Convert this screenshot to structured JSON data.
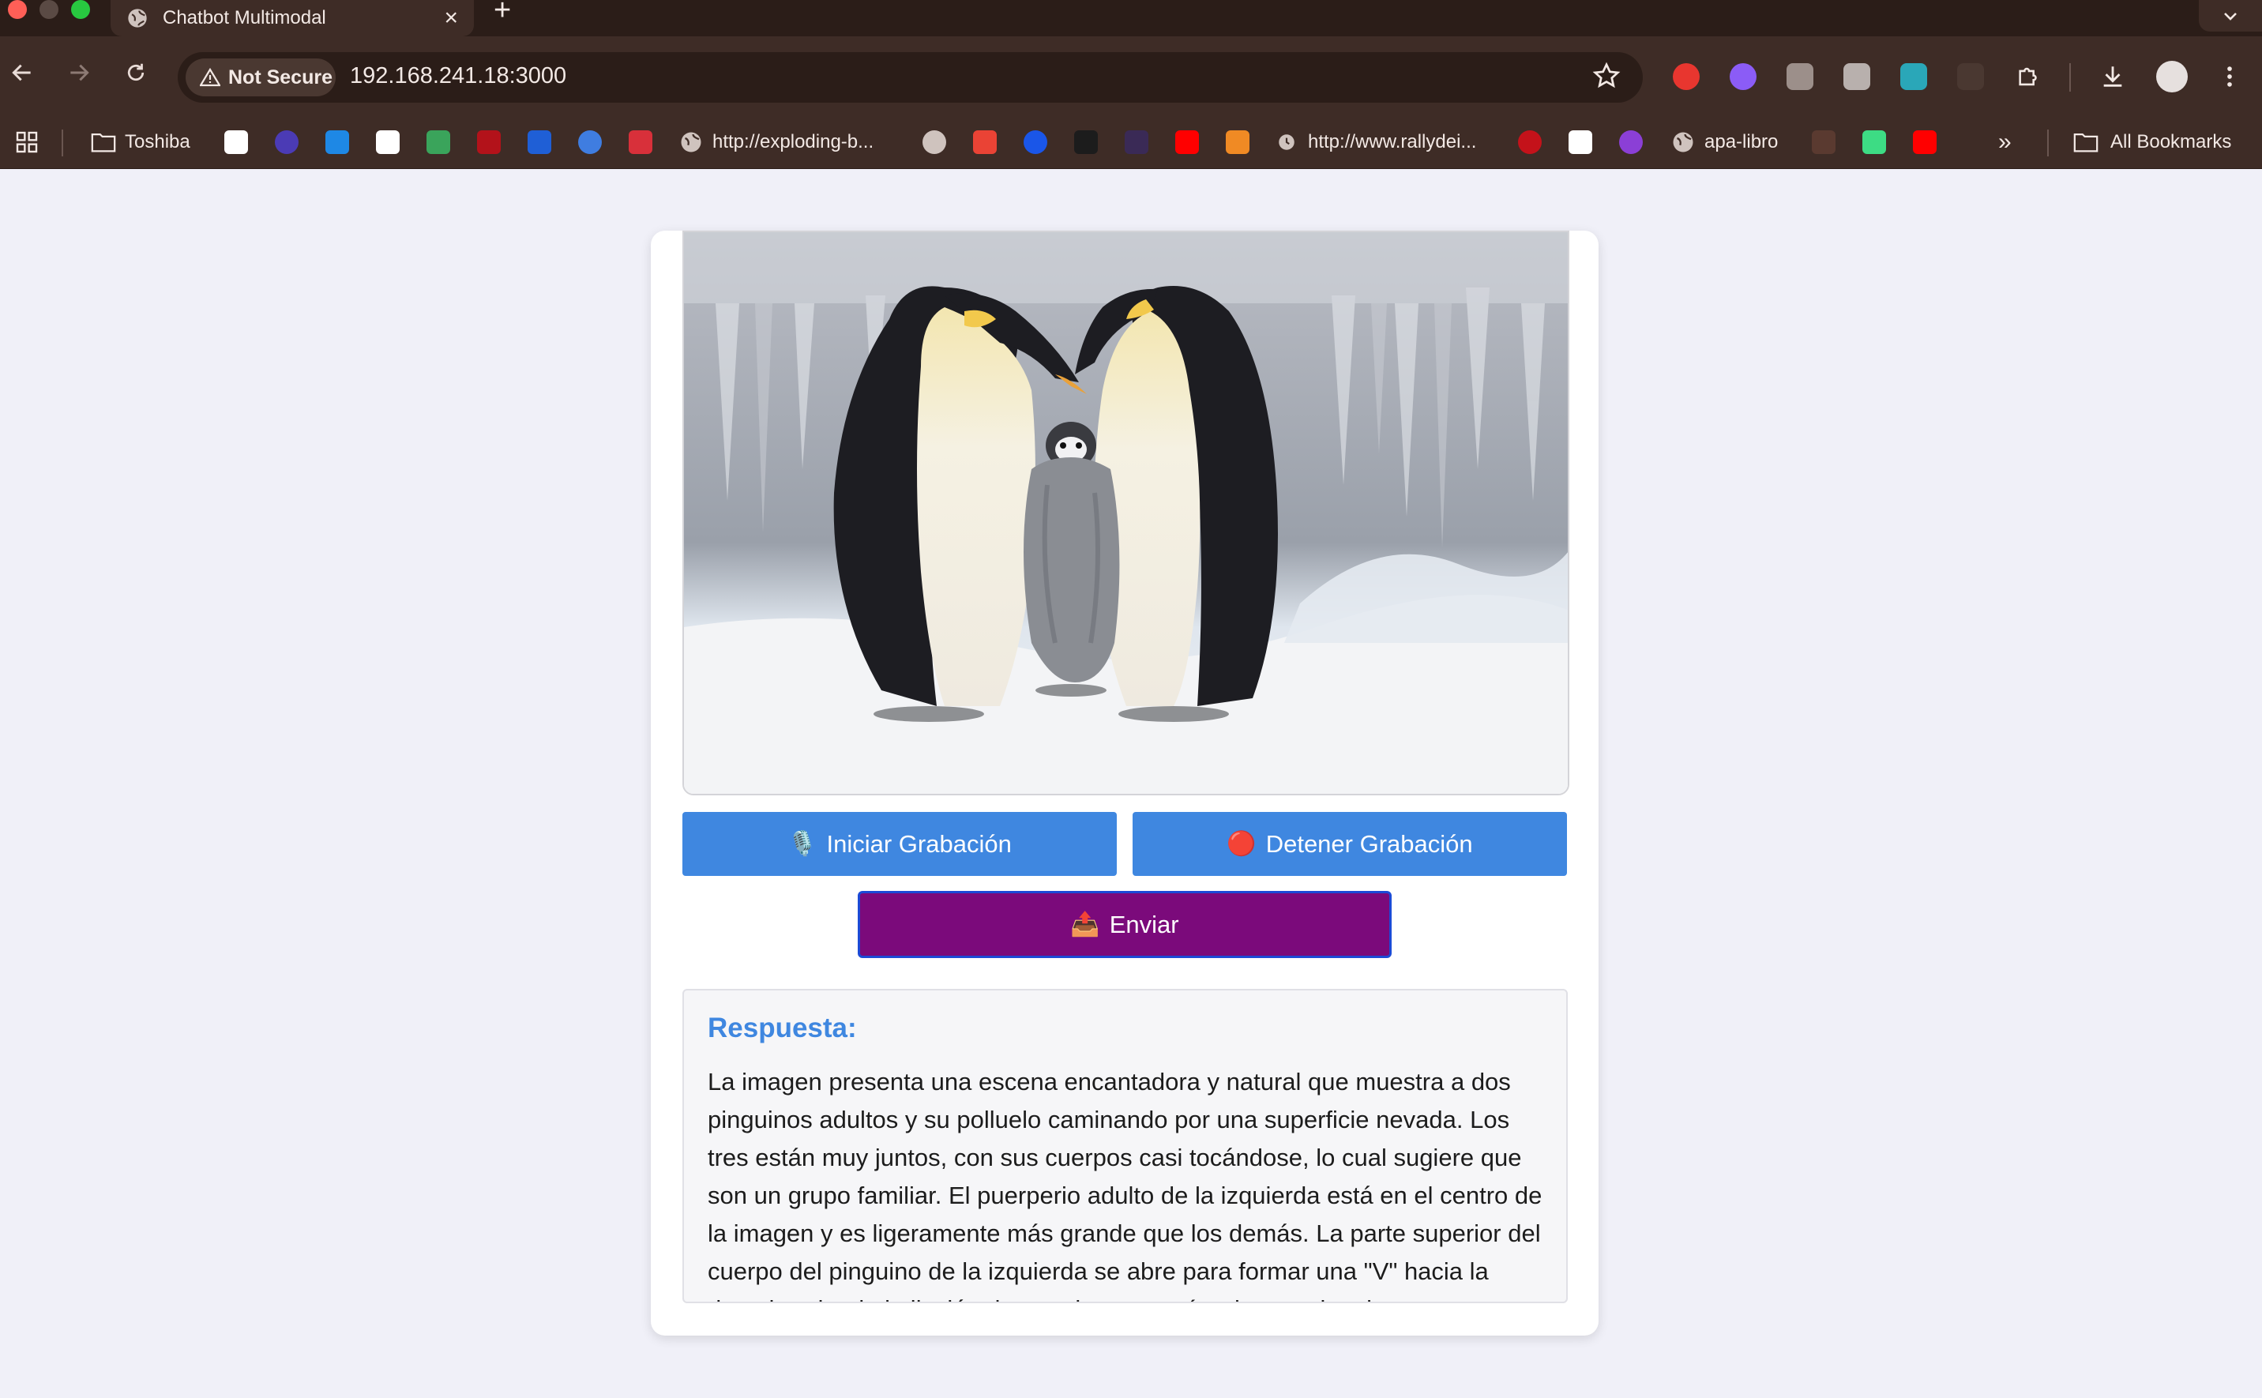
{
  "browser": {
    "tab_title": "Chatbot Multimodal",
    "new_tab_symbol": "+",
    "close_symbol": "×",
    "security_label": "Not Secure",
    "url": "192.168.241.18:3000",
    "bookmarks": [
      {
        "icon": "folder-icon",
        "label": "Toshiba"
      },
      {
        "icon": "globe-icon",
        "label": "http://exploding-b..."
      },
      {
        "icon": "globe-icon",
        "label": "http://www.rallydei..."
      },
      {
        "icon": "globe-icon",
        "label": "apa-libro"
      },
      {
        "icon": "folder-icon",
        "label": "All Bookmarks"
      }
    ],
    "more_bookmarks_symbol": "»"
  },
  "app": {
    "image_alt": "Emperor penguins with chick",
    "record_button": {
      "emoji": "🎙️",
      "label": "Iniciar Grabación"
    },
    "stop_button": {
      "emoji": "🔴",
      "label": "Detener Grabación"
    },
    "send_button": {
      "emoji": "📤",
      "label": "Enviar"
    },
    "response": {
      "title": "Respuesta:",
      "text": "La imagen presenta una escena encantadora y natural que muestra a dos pinguinos adultos y su polluelo caminando por una superficie nevada. Los tres están muy juntos, con sus cuerpos casi tocándose, lo cual sugiere que son un grupo familiar. El puerperio adulto de la izquierda está en el centro de la imagen y es ligeramente más grande que los demás. La parte superior del cuerpo del pinguino de la izquierda se abre para formar una \"V\" hacia la derecha, dando la ilusión de que tienen un vínculo emocional."
    }
  },
  "colors": {
    "primary_button": "#3f87e0",
    "send_button": "#7b0a7b",
    "response_title": "#3f87e0"
  }
}
